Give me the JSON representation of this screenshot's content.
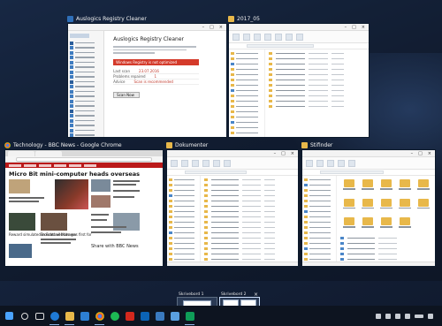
{
  "windows": {
    "registry": {
      "title": "Auslogics Registry Cleaner",
      "app_heading": "Auslogics Registry Cleaner",
      "alert": "Windows Registry is not optimized",
      "stats": [
        {
          "k": "Last scan",
          "v": "23.07.2016"
        },
        {
          "k": "Problems repaired",
          "v": "1"
        },
        {
          "k": "Advice",
          "v": "Scan is recommended"
        }
      ],
      "button": "Scan Now"
    },
    "explorer1": {
      "title": "2017_05"
    },
    "chrome": {
      "title": "Technology - BBC News - Google Chrome",
      "headline": "Micro Bit mini-computer heads overseas",
      "captions": [
        "Reward simulated in Football Manager",
        "Broader website was first for",
        "Share with BBC News"
      ]
    },
    "explorer2": {
      "title": "Dokumenter"
    },
    "explorer3": {
      "title": "Stifinder"
    }
  },
  "workspaces": [
    {
      "label": "Skrivebord 1"
    },
    {
      "label": "Skrivebord 2",
      "close": "×"
    }
  ],
  "new_desktop": "+",
  "colors": {
    "accent": "#0078d7",
    "bbc_red": "#bb1919",
    "folder": "#e8b84a"
  },
  "taskbar": {
    "icons": [
      "windows-icon",
      "search-icon",
      "task-view-icon",
      "edge-icon",
      "folder-icon",
      "store-icon",
      "chrome-icon",
      "spotify-icon",
      "acrobat-icon",
      "outlook-icon",
      "app-icon",
      "image-icon",
      "app2-icon"
    ]
  }
}
